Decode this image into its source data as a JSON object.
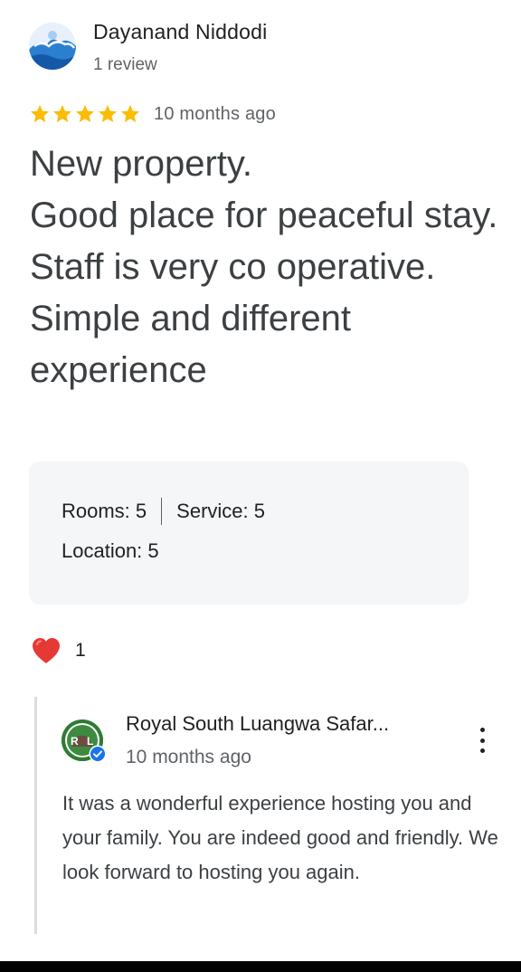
{
  "reviewer": {
    "name": "Dayanand Niddodi",
    "meta": "1 review"
  },
  "review": {
    "stars": 5,
    "date": "10 months ago",
    "text": "New property.\nGood place for peaceful stay.\nStaff is very co operative.\nSimple and different experience",
    "ratings": {
      "rooms_label": "Rooms:",
      "rooms_value": "5",
      "service_label": "Service:",
      "service_value": "5",
      "location_label": "Location:",
      "location_value": "5"
    }
  },
  "reaction": {
    "icon": "heart-icon",
    "count": "1"
  },
  "owner_reply": {
    "name": "Royal South Luangwa Safar...",
    "date": "10 months ago",
    "text": "It was a wonderful experience hosting you and your family. You are indeed good and friendly. We look forward to hosting you again.",
    "avatar_initials": "RL"
  },
  "colors": {
    "star": "#fbbc04",
    "heart": "#e53935",
    "verified": "#1a73e8"
  }
}
